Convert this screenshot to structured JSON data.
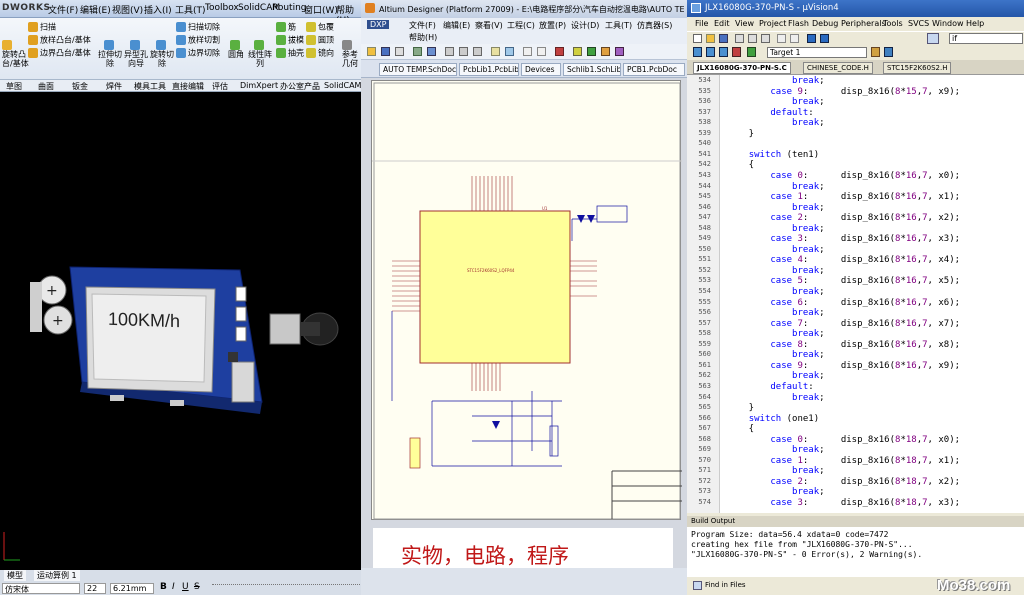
{
  "solidworks": {
    "logo": "DWORKS",
    "menu": [
      "文件(F)",
      "编辑(E)",
      "视图(V)",
      "插入(I)",
      "工具(T)",
      "Toolbox",
      "SolidCAM",
      "Routing",
      "窗口(W)",
      "帮助(H)"
    ],
    "ribbon": {
      "col1": [
        "旋转凸",
        "台/基体"
      ],
      "col2": [
        "扫描",
        "放样凸台/基体",
        "边界凸台/基体"
      ],
      "col3": [
        "拉伸切",
        "除"
      ],
      "col4": [
        "异型孔",
        "向导"
      ],
      "col5": [
        "旋转切",
        "除"
      ],
      "col6": [
        "扫描切除",
        "放样切割",
        "边界切除"
      ],
      "col7": [
        "圆角"
      ],
      "col8": [
        "线性阵",
        "列"
      ],
      "col9": [
        "筋",
        "拔模",
        "抽壳"
      ],
      "col10": [
        "包覆",
        "圆顶",
        "镜向"
      ],
      "col11": [
        "参考",
        "几何"
      ]
    },
    "tabs": [
      "草图",
      "曲面",
      "钣金",
      "焊件",
      "模具工具",
      "直接编辑",
      "评估",
      "DimXpert",
      "办公室产品",
      "SolidCAM"
    ],
    "display_text": "100KM/h",
    "bottom_tabs": [
      "模型",
      "运动算例 1"
    ],
    "font_name": "仿宋体",
    "font_size": "22",
    "font_height": "6.21mm"
  },
  "altium": {
    "title": "Altium Designer (Platform 27009) - E:\\电路程序部分\\汽车自动挖温电路\\AUTO TEMP.SchDoc",
    "menu": [
      "DXP",
      "文件(F)",
      "编辑(E)",
      "察看(V)",
      "工程(C)",
      "放置(P)",
      "设计(D)",
      "工具(T)",
      "仿真器(S)",
      "帮助(H)"
    ],
    "doc_tabs": [
      "AUTO TEMP.SchDoc",
      "PcbLib1.PcbLib",
      "Devices",
      "Schlib1.SchLib",
      "PCB1.PcbDoc"
    ],
    "chip_name": "STC15F2K60S2_LQFP44",
    "chip_ref": "U1",
    "caption": "实物，电路，程序"
  },
  "keil": {
    "title": "JLX16080G-370-PN-S - µVision4",
    "menu": [
      "File",
      "Edit",
      "View",
      "Project",
      "Flash",
      "Debug",
      "Peripherals",
      "Tools",
      "SVCS",
      "Window",
      "Help"
    ],
    "target": "Target 1",
    "search": "if",
    "tabs": [
      "JLX16080G-370-PN-S.C",
      "CHINESE_CODE.H",
      "STC15F2K60S2.H"
    ],
    "code_lines": [
      {
        "n": "534",
        "t": "            break;"
      },
      {
        "n": "535",
        "t": "        case 9:      disp_8x16(8*15,7, x9);"
      },
      {
        "n": "536",
        "t": "            break;"
      },
      {
        "n": "537",
        "t": "        default:"
      },
      {
        "n": "538",
        "t": "            break;"
      },
      {
        "n": "539",
        "t": "    }"
      },
      {
        "n": "540",
        "t": ""
      },
      {
        "n": "541",
        "t": "    switch (ten1)"
      },
      {
        "n": "542",
        "t": "    {"
      },
      {
        "n": "543",
        "t": "        case 0:      disp_8x16(8*16,7, x0);"
      },
      {
        "n": "544",
        "t": "            break;"
      },
      {
        "n": "545",
        "t": "        case 1:      disp_8x16(8*16,7, x1);"
      },
      {
        "n": "546",
        "t": "            break;"
      },
      {
        "n": "547",
        "t": "        case 2:      disp_8x16(8*16,7, x2);"
      },
      {
        "n": "548",
        "t": "            break;"
      },
      {
        "n": "549",
        "t": "        case 3:      disp_8x16(8*16,7, x3);"
      },
      {
        "n": "550",
        "t": "            break;"
      },
      {
        "n": "551",
        "t": "        case 4:      disp_8x16(8*16,7, x4);"
      },
      {
        "n": "552",
        "t": "            break;"
      },
      {
        "n": "553",
        "t": "        case 5:      disp_8x16(8*16,7, x5);"
      },
      {
        "n": "554",
        "t": "            break;"
      },
      {
        "n": "555",
        "t": "        case 6:      disp_8x16(8*16,7, x6);"
      },
      {
        "n": "556",
        "t": "            break;"
      },
      {
        "n": "557",
        "t": "        case 7:      disp_8x16(8*16,7, x7);"
      },
      {
        "n": "558",
        "t": "            break;"
      },
      {
        "n": "559",
        "t": "        case 8:      disp_8x16(8*16,7, x8);"
      },
      {
        "n": "560",
        "t": "            break;"
      },
      {
        "n": "561",
        "t": "        case 9:      disp_8x16(8*16,7, x9);"
      },
      {
        "n": "562",
        "t": "            break;"
      },
      {
        "n": "563",
        "t": "        default:"
      },
      {
        "n": "564",
        "t": "            break;"
      },
      {
        "n": "565",
        "t": "    }"
      },
      {
        "n": "566",
        "t": "    switch (one1)"
      },
      {
        "n": "567",
        "t": "    {"
      },
      {
        "n": "568",
        "t": "        case 0:      disp_8x16(8*18,7, x0);"
      },
      {
        "n": "569",
        "t": "            break;"
      },
      {
        "n": "570",
        "t": "        case 1:      disp_8x16(8*18,7, x1);"
      },
      {
        "n": "571",
        "t": "            break;"
      },
      {
        "n": "572",
        "t": "        case 2:      disp_8x16(8*18,7, x2);"
      },
      {
        "n": "573",
        "t": "            break;"
      },
      {
        "n": "574",
        "t": "        case 3:      disp_8x16(8*18,7, x3);"
      }
    ],
    "build_header": "Build Output",
    "build_lines": [
      "Program Size: data=56.4 xdata=0 code=7472",
      "creating hex file from \"JLX16080G-370-PN-S\"...",
      "\"JLX16080G-370-PN-S\" - 0 Error(s), 2 Warning(s)."
    ],
    "find_label": "Find in Files",
    "watermark": "Mo38.com"
  }
}
